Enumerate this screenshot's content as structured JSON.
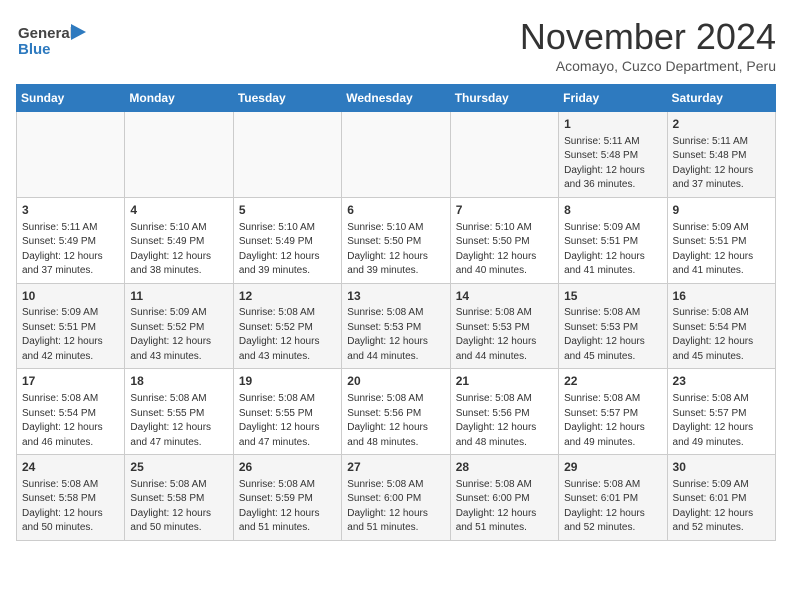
{
  "header": {
    "logo_general": "General",
    "logo_blue": "Blue",
    "month_year": "November 2024",
    "location": "Acomayo, Cuzco Department, Peru"
  },
  "days_of_week": [
    "Sunday",
    "Monday",
    "Tuesday",
    "Wednesday",
    "Thursday",
    "Friday",
    "Saturday"
  ],
  "weeks": [
    [
      {
        "day": "",
        "info": ""
      },
      {
        "day": "",
        "info": ""
      },
      {
        "day": "",
        "info": ""
      },
      {
        "day": "",
        "info": ""
      },
      {
        "day": "",
        "info": ""
      },
      {
        "day": "1",
        "info": "Sunrise: 5:11 AM\nSunset: 5:48 PM\nDaylight: 12 hours\nand 36 minutes."
      },
      {
        "day": "2",
        "info": "Sunrise: 5:11 AM\nSunset: 5:48 PM\nDaylight: 12 hours\nand 37 minutes."
      }
    ],
    [
      {
        "day": "3",
        "info": "Sunrise: 5:11 AM\nSunset: 5:49 PM\nDaylight: 12 hours\nand 37 minutes."
      },
      {
        "day": "4",
        "info": "Sunrise: 5:10 AM\nSunset: 5:49 PM\nDaylight: 12 hours\nand 38 minutes."
      },
      {
        "day": "5",
        "info": "Sunrise: 5:10 AM\nSunset: 5:49 PM\nDaylight: 12 hours\nand 39 minutes."
      },
      {
        "day": "6",
        "info": "Sunrise: 5:10 AM\nSunset: 5:50 PM\nDaylight: 12 hours\nand 39 minutes."
      },
      {
        "day": "7",
        "info": "Sunrise: 5:10 AM\nSunset: 5:50 PM\nDaylight: 12 hours\nand 40 minutes."
      },
      {
        "day": "8",
        "info": "Sunrise: 5:09 AM\nSunset: 5:51 PM\nDaylight: 12 hours\nand 41 minutes."
      },
      {
        "day": "9",
        "info": "Sunrise: 5:09 AM\nSunset: 5:51 PM\nDaylight: 12 hours\nand 41 minutes."
      }
    ],
    [
      {
        "day": "10",
        "info": "Sunrise: 5:09 AM\nSunset: 5:51 PM\nDaylight: 12 hours\nand 42 minutes."
      },
      {
        "day": "11",
        "info": "Sunrise: 5:09 AM\nSunset: 5:52 PM\nDaylight: 12 hours\nand 43 minutes."
      },
      {
        "day": "12",
        "info": "Sunrise: 5:08 AM\nSunset: 5:52 PM\nDaylight: 12 hours\nand 43 minutes."
      },
      {
        "day": "13",
        "info": "Sunrise: 5:08 AM\nSunset: 5:53 PM\nDaylight: 12 hours\nand 44 minutes."
      },
      {
        "day": "14",
        "info": "Sunrise: 5:08 AM\nSunset: 5:53 PM\nDaylight: 12 hours\nand 44 minutes."
      },
      {
        "day": "15",
        "info": "Sunrise: 5:08 AM\nSunset: 5:53 PM\nDaylight: 12 hours\nand 45 minutes."
      },
      {
        "day": "16",
        "info": "Sunrise: 5:08 AM\nSunset: 5:54 PM\nDaylight: 12 hours\nand 45 minutes."
      }
    ],
    [
      {
        "day": "17",
        "info": "Sunrise: 5:08 AM\nSunset: 5:54 PM\nDaylight: 12 hours\nand 46 minutes."
      },
      {
        "day": "18",
        "info": "Sunrise: 5:08 AM\nSunset: 5:55 PM\nDaylight: 12 hours\nand 47 minutes."
      },
      {
        "day": "19",
        "info": "Sunrise: 5:08 AM\nSunset: 5:55 PM\nDaylight: 12 hours\nand 47 minutes."
      },
      {
        "day": "20",
        "info": "Sunrise: 5:08 AM\nSunset: 5:56 PM\nDaylight: 12 hours\nand 48 minutes."
      },
      {
        "day": "21",
        "info": "Sunrise: 5:08 AM\nSunset: 5:56 PM\nDaylight: 12 hours\nand 48 minutes."
      },
      {
        "day": "22",
        "info": "Sunrise: 5:08 AM\nSunset: 5:57 PM\nDaylight: 12 hours\nand 49 minutes."
      },
      {
        "day": "23",
        "info": "Sunrise: 5:08 AM\nSunset: 5:57 PM\nDaylight: 12 hours\nand 49 minutes."
      }
    ],
    [
      {
        "day": "24",
        "info": "Sunrise: 5:08 AM\nSunset: 5:58 PM\nDaylight: 12 hours\nand 50 minutes."
      },
      {
        "day": "25",
        "info": "Sunrise: 5:08 AM\nSunset: 5:58 PM\nDaylight: 12 hours\nand 50 minutes."
      },
      {
        "day": "26",
        "info": "Sunrise: 5:08 AM\nSunset: 5:59 PM\nDaylight: 12 hours\nand 51 minutes."
      },
      {
        "day": "27",
        "info": "Sunrise: 5:08 AM\nSunset: 6:00 PM\nDaylight: 12 hours\nand 51 minutes."
      },
      {
        "day": "28",
        "info": "Sunrise: 5:08 AM\nSunset: 6:00 PM\nDaylight: 12 hours\nand 51 minutes."
      },
      {
        "day": "29",
        "info": "Sunrise: 5:08 AM\nSunset: 6:01 PM\nDaylight: 12 hours\nand 52 minutes."
      },
      {
        "day": "30",
        "info": "Sunrise: 5:09 AM\nSunset: 6:01 PM\nDaylight: 12 hours\nand 52 minutes."
      }
    ]
  ]
}
